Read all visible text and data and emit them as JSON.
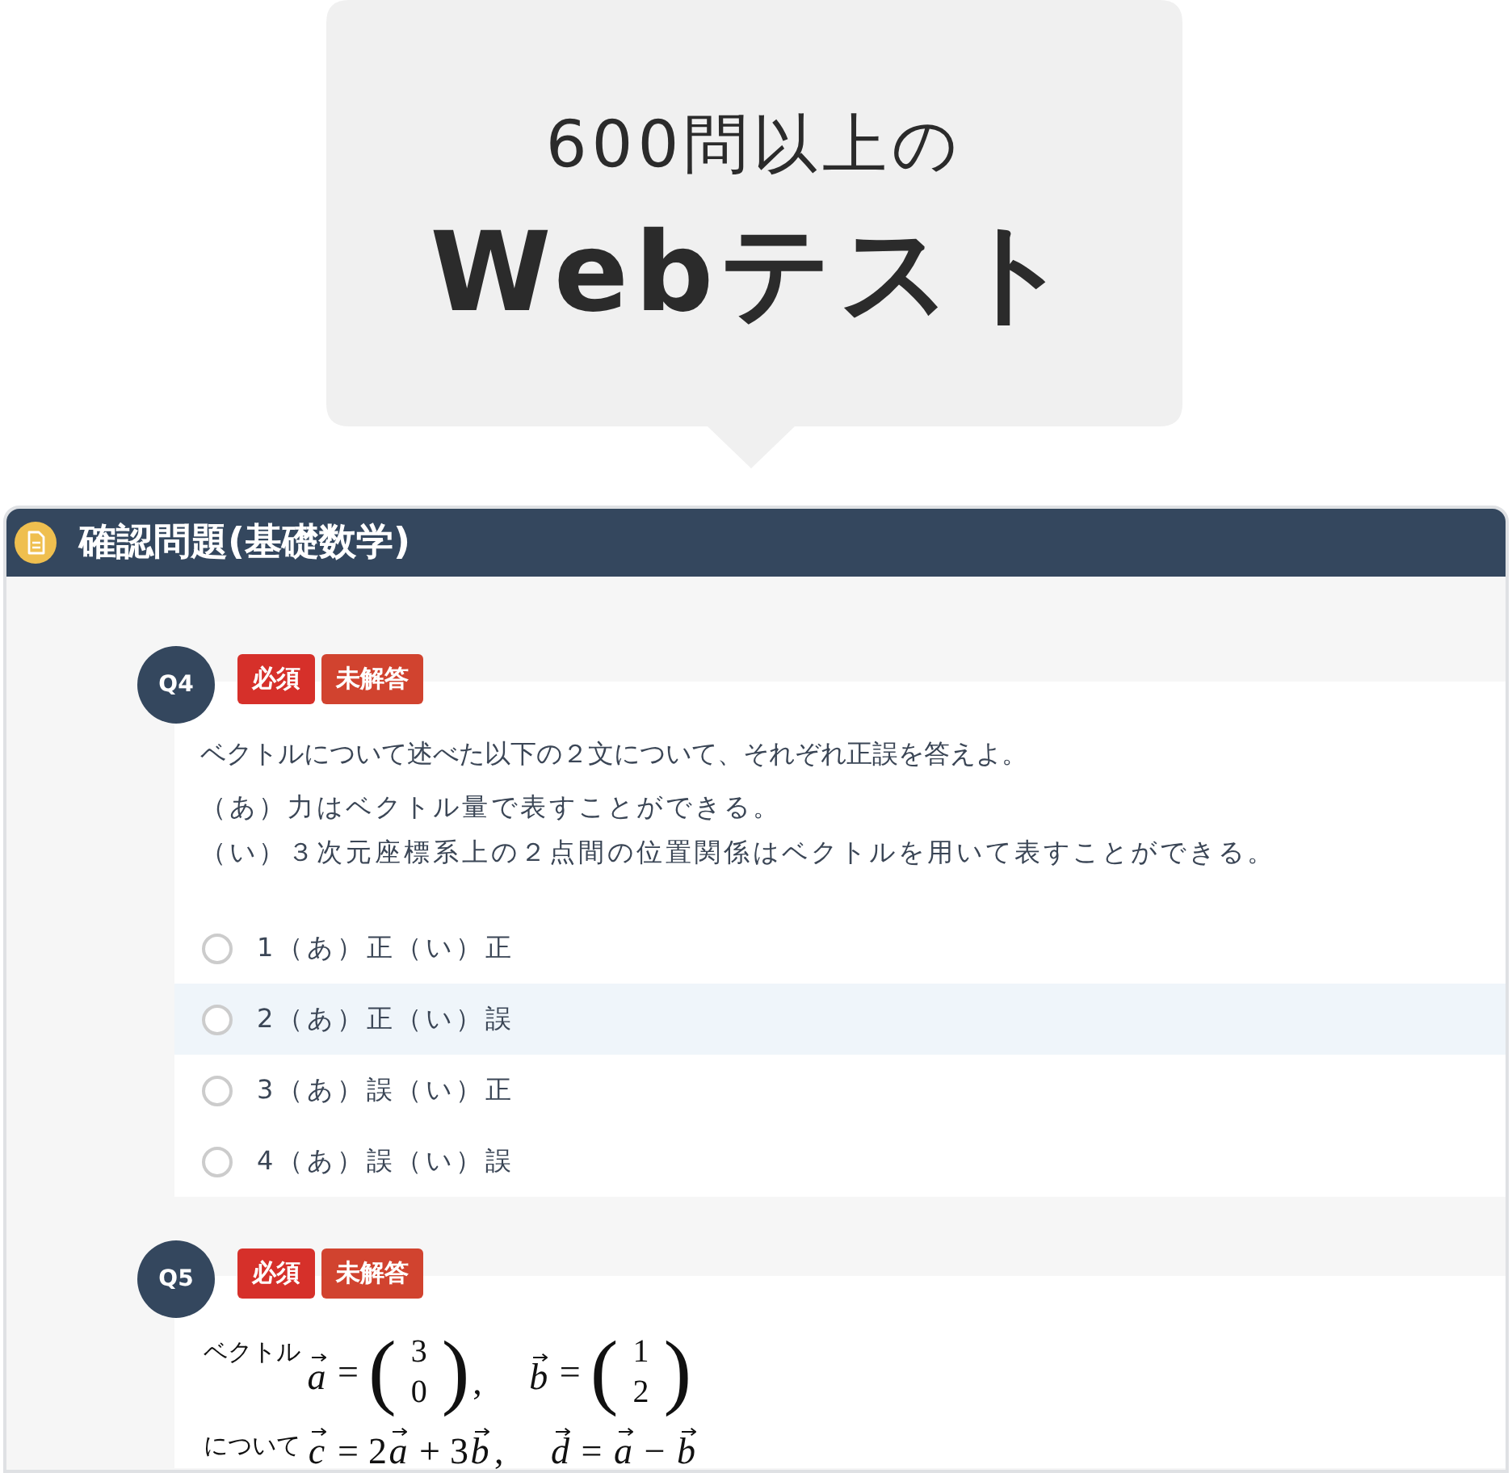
{
  "callout": {
    "subtitle": "600問以上の",
    "title": "Webテスト"
  },
  "panel": {
    "title": "確認問題(基礎数学)"
  },
  "questions": [
    {
      "number": "Q4",
      "kind": "choice",
      "badges": [
        {
          "kind": "required",
          "text": "必須"
        },
        {
          "kind": "unanswered",
          "text": "未解答"
        }
      ],
      "prompt": "ベクトルについて述べた以下の２文について、それぞれ正誤を答えよ。",
      "statements": [
        "（あ）力はベクトル量で表すことができる。",
        "（い）３次元座標系上の２点間の位置関係はベクトルを用いて表すことができる。"
      ],
      "options": [
        {
          "label": "1（あ）正（い）正",
          "selected": false,
          "highlighted": false
        },
        {
          "label": "2（あ）正（い）誤",
          "selected": false,
          "highlighted": true
        },
        {
          "label": "3（あ）誤（い）正",
          "selected": false,
          "highlighted": false
        },
        {
          "label": "4（あ）誤（い）誤",
          "selected": false,
          "highlighted": false
        }
      ]
    },
    {
      "number": "Q5",
      "kind": "formula",
      "badges": [
        {
          "kind": "required",
          "text": "必須"
        },
        {
          "kind": "unanswered",
          "text": "未解答"
        }
      ],
      "formula_lines": [
        {
          "lead": "ベクトル",
          "parts": [
            {
              "kind": "vector",
              "text": "a"
            },
            {
              "kind": "operator",
              "text": "="
            },
            {
              "kind": "column",
              "open": "(",
              "entries": [
                "3",
                "0"
              ],
              "close": ")"
            },
            {
              "kind": "punct",
              "text": ","
            },
            {
              "kind": "vector",
              "text": "b"
            },
            {
              "kind": "operator",
              "text": "="
            },
            {
              "kind": "column",
              "open": "(",
              "entries": [
                "1",
                "2"
              ],
              "close": ")"
            }
          ]
        },
        {
          "lead": "について",
          "parts": [
            {
              "kind": "vector",
              "text": "c"
            },
            {
              "kind": "operator",
              "text": "="
            },
            {
              "kind": "number",
              "text": "2"
            },
            {
              "kind": "vector",
              "text": "a"
            },
            {
              "kind": "operator",
              "text": "+"
            },
            {
              "kind": "number",
              "text": "3"
            },
            {
              "kind": "vector",
              "text": "b"
            },
            {
              "kind": "punct",
              "text": ","
            },
            {
              "kind": "vector",
              "text": "d"
            },
            {
              "kind": "operator",
              "text": "="
            },
            {
              "kind": "vector",
              "text": "a"
            },
            {
              "kind": "operator",
              "text": "−"
            },
            {
              "kind": "vector",
              "text": "b"
            }
          ]
        }
      ]
    }
  ]
}
